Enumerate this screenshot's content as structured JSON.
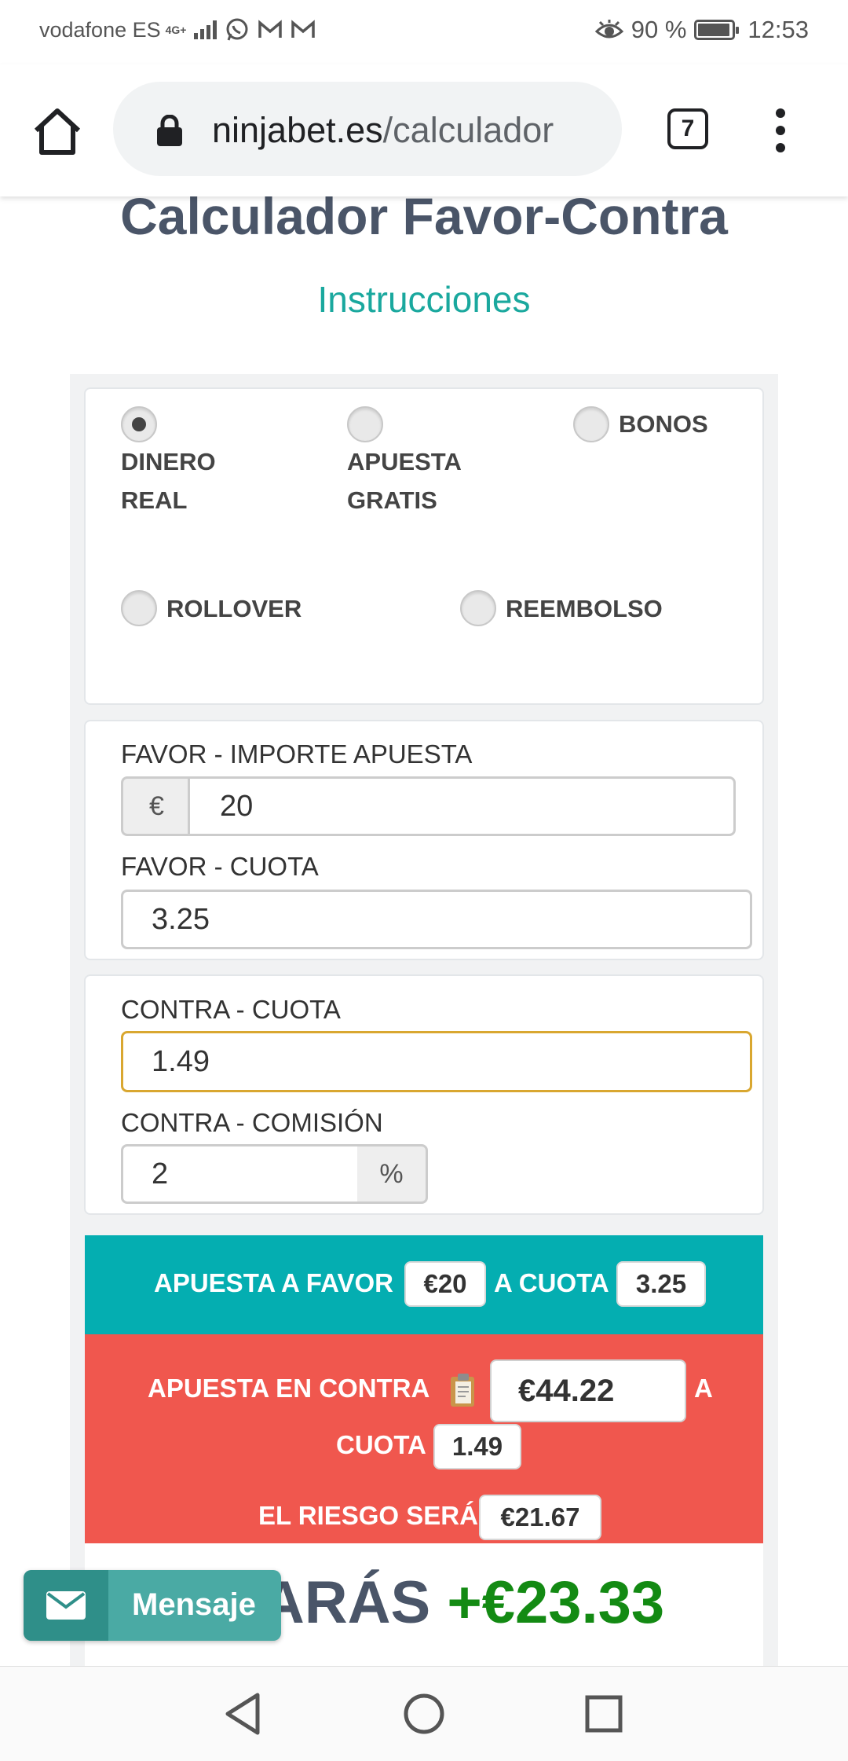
{
  "status_bar": {
    "carrier": "vodafone ES",
    "network": "4G+",
    "battery": "90 %",
    "time": "12:53",
    "icons": [
      "whatsapp-icon",
      "gmail-icon",
      "gmail-icon",
      "eye-icon",
      "signal-icon",
      "battery-icon"
    ]
  },
  "browser": {
    "url_domain": "ninjabet.es",
    "url_path": "/calculador",
    "tab_count": "7"
  },
  "page": {
    "title": "Calculador Favor-Contra",
    "instructions_link": "Instrucciones"
  },
  "bet_types": {
    "options": [
      {
        "label": "DINERO REAL",
        "line1": "DINERO",
        "line2": "REAL",
        "checked": true
      },
      {
        "label": "APUESTA GRATIS",
        "line1": "APUESTA",
        "line2": "GRATIS",
        "checked": false
      },
      {
        "label": "BONOS",
        "checked": false
      },
      {
        "label": "ROLLOVER",
        "checked": false
      },
      {
        "label": "REEMBOLSO",
        "checked": false
      }
    ]
  },
  "favor": {
    "amount_label": "FAVOR - IMPORTE APUESTA",
    "currency": "€",
    "amount_value": "20",
    "odds_label": "FAVOR - CUOTA",
    "odds_value": "3.25"
  },
  "contra": {
    "odds_label": "CONTRA - CUOTA",
    "odds_value": "1.49",
    "commission_label": "CONTRA - COMISIÓN",
    "commission_value": "2",
    "commission_unit": "%"
  },
  "results": {
    "favor_text": "APUESTA A FAVOR",
    "favor_amount": "€20",
    "favor_odds_text": "A CUOTA",
    "favor_odds": "3.25",
    "contra_text": "APUESTA EN CONTRA",
    "contra_amount": "€44.22",
    "contra_a": "A",
    "contra_cuota_text": "CUOTA",
    "contra_odds": "1.49",
    "risk_text": "EL RIESGO SERÁ",
    "risk_amount": "€21.67",
    "gain_text": "NARÁS",
    "gain_amount": "+€23.33"
  },
  "message_widget": {
    "label": "Mensaje"
  },
  "colors": {
    "teal": "#04aeb1",
    "red": "#f0574e",
    "gain_green": "#138a13",
    "link_teal": "#1aa89e",
    "focus_border": "#d9a730"
  }
}
